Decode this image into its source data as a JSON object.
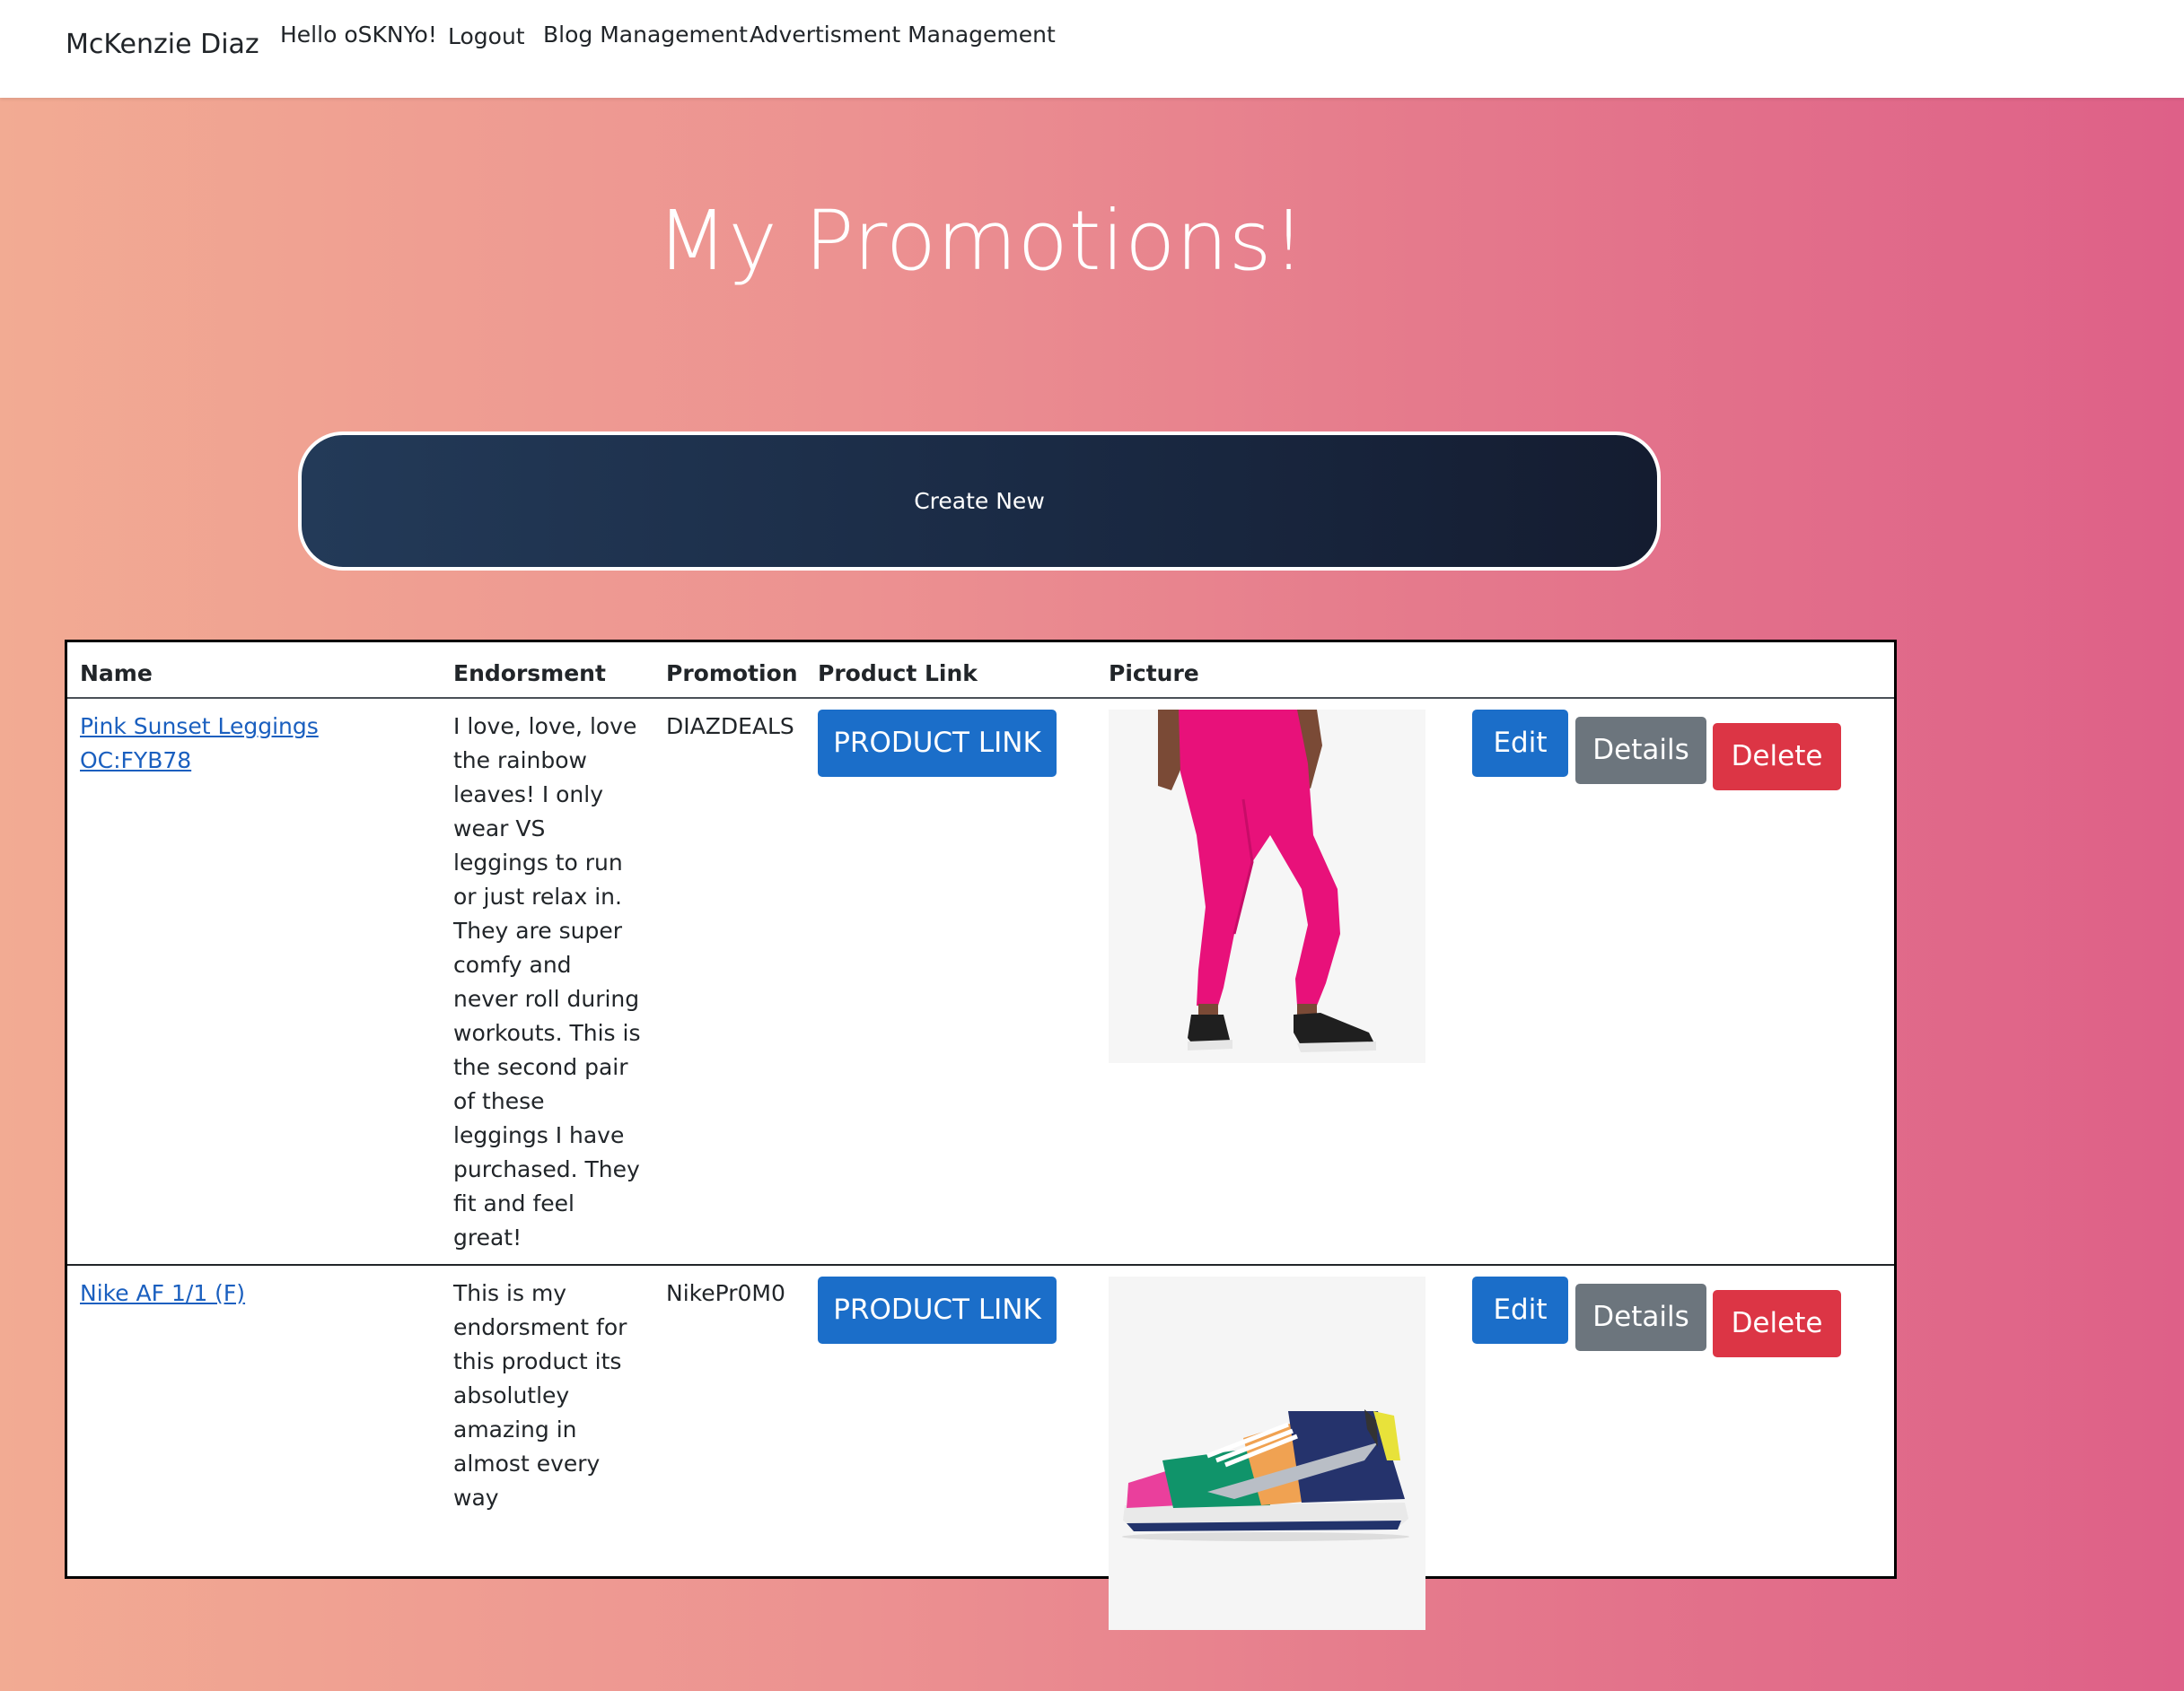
{
  "navbar": {
    "brand": "McKenzie Diaz",
    "links": [
      "Hello oSKNYo!",
      "Logout",
      "Blog Management",
      "Advertisment Management"
    ]
  },
  "page": {
    "title": "My Promotions!",
    "create_new_label": "Create New"
  },
  "table": {
    "headers": [
      "Name",
      "Endorsment",
      "Promotion",
      "Product Link",
      "Picture"
    ],
    "rows": [
      {
        "name": "Pink Sunset Leggings OC:FYB78",
        "endorsement": "I love, love, love the rainbow leaves! I only wear VS leggings to run or just relax in. They are super comfy and never roll during workouts. This is the second pair of these leggings I have purchased. They fit and feel great!",
        "promotion": "DIAZDEALS",
        "product_link_label": "PRODUCT LINK",
        "picture": "pink-leggings-image",
        "edit_label": "Edit",
        "details_label": "Details",
        "delete_label": "Delete"
      },
      {
        "name": "Nike AF 1/1 (F)",
        "endorsement": "This is my endorsment for this product its absolutley amazing in almost every way",
        "promotion": "NikePr0M0",
        "product_link_label": "PRODUCT LINK",
        "picture": "nike-sneaker-image",
        "edit_label": "Edit",
        "details_label": "Details",
        "delete_label": "Delete"
      }
    ]
  },
  "colors": {
    "gradient_start": "#f2ab93",
    "gradient_end": "#de6088",
    "create_button": "#1a2a44",
    "primary": "#1b6ec9",
    "secondary": "#6c757d",
    "danger": "#dc3545",
    "link": "#1a5fbf"
  }
}
